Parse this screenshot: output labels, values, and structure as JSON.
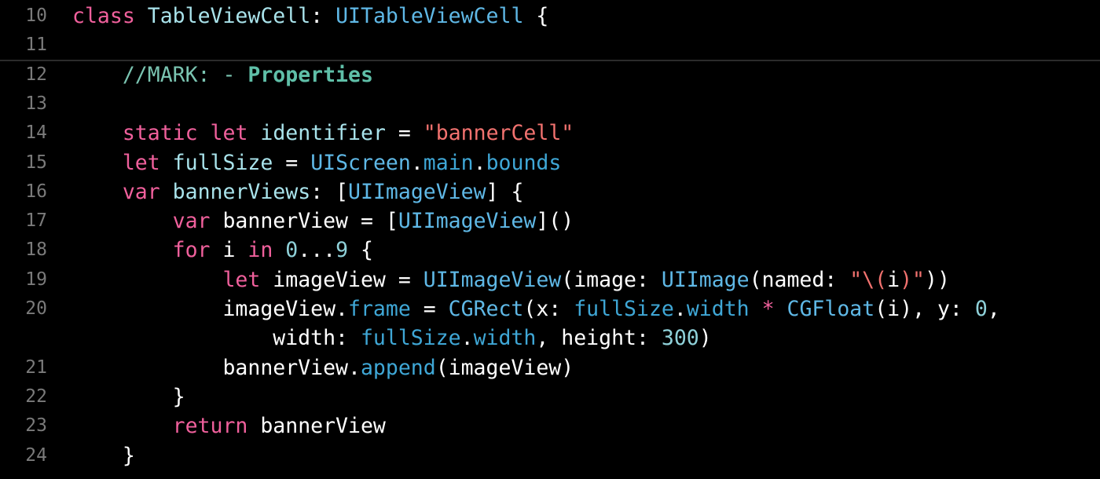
{
  "editor": {
    "background": "#000000",
    "colors": {
      "keyword": "#f0609c",
      "type": "#5fb8e6",
      "declaration": "#a9e3eb",
      "property": "#3fa7d6",
      "string": "#f2726f",
      "number": "#8fd1d9",
      "mark": "#7ac4b1",
      "line_number": "#7a7a7a"
    },
    "lines": [
      {
        "num": "10",
        "tokens": [
          [
            "kw",
            "class"
          ],
          [
            "plain",
            " "
          ],
          [
            "decl",
            "TableViewCell"
          ],
          [
            "plain",
            ": "
          ],
          [
            "type",
            "UITableViewCell"
          ],
          [
            "plain",
            " {"
          ]
        ]
      },
      {
        "num": "11",
        "tokens": []
      },
      {
        "num": "12",
        "tokens": [
          [
            "plain",
            "    "
          ],
          [
            "mark",
            "//MARK: - "
          ],
          [
            "mark-b",
            "Properties"
          ]
        ]
      },
      {
        "num": "13",
        "tokens": []
      },
      {
        "num": "14",
        "tokens": [
          [
            "plain",
            "    "
          ],
          [
            "kw",
            "static"
          ],
          [
            "plain",
            " "
          ],
          [
            "kw",
            "let"
          ],
          [
            "plain",
            " "
          ],
          [
            "decl",
            "identifier"
          ],
          [
            "plain",
            " = "
          ],
          [
            "str",
            "\"bannerCell\""
          ]
        ]
      },
      {
        "num": "15",
        "tokens": [
          [
            "plain",
            "    "
          ],
          [
            "kw",
            "let"
          ],
          [
            "plain",
            " "
          ],
          [
            "decl",
            "fullSize"
          ],
          [
            "plain",
            " = "
          ],
          [
            "type",
            "UIScreen"
          ],
          [
            "plain",
            "."
          ],
          [
            "prop",
            "main"
          ],
          [
            "plain",
            "."
          ],
          [
            "prop",
            "bounds"
          ]
        ]
      },
      {
        "num": "16",
        "tokens": [
          [
            "plain",
            "    "
          ],
          [
            "kw",
            "var"
          ],
          [
            "plain",
            " "
          ],
          [
            "decl",
            "bannerViews"
          ],
          [
            "plain",
            ": ["
          ],
          [
            "type",
            "UIImageView"
          ],
          [
            "plain",
            "] {"
          ]
        ]
      },
      {
        "num": "17",
        "tokens": [
          [
            "plain",
            "        "
          ],
          [
            "kw",
            "var"
          ],
          [
            "plain",
            " bannerView = ["
          ],
          [
            "type",
            "UIImageView"
          ],
          [
            "plain",
            "]()"
          ]
        ]
      },
      {
        "num": "18",
        "tokens": [
          [
            "plain",
            "        "
          ],
          [
            "kw",
            "for"
          ],
          [
            "plain",
            " i "
          ],
          [
            "kw",
            "in"
          ],
          [
            "plain",
            " "
          ],
          [
            "num",
            "0"
          ],
          [
            "plain",
            "..."
          ],
          [
            "num",
            "9"
          ],
          [
            "plain",
            " {"
          ]
        ]
      },
      {
        "num": "19",
        "tokens": [
          [
            "plain",
            "            "
          ],
          [
            "kw",
            "let"
          ],
          [
            "plain",
            " imageView = "
          ],
          [
            "type",
            "UIImageView"
          ],
          [
            "plain",
            "(image: "
          ],
          [
            "type",
            "UIImage"
          ],
          [
            "plain",
            "(named: "
          ],
          [
            "str",
            "\"\\("
          ],
          [
            "plain",
            "i"
          ],
          [
            "str",
            ")\""
          ],
          [
            "plain",
            "))"
          ]
        ]
      },
      {
        "num": "20",
        "tokens": [
          [
            "plain",
            "            imageView."
          ],
          [
            "prop",
            "frame"
          ],
          [
            "plain",
            " = "
          ],
          [
            "type",
            "CGRect"
          ],
          [
            "plain",
            "(x: "
          ],
          [
            "prop",
            "fullSize"
          ],
          [
            "plain",
            "."
          ],
          [
            "prop",
            "width"
          ],
          [
            "plain",
            " "
          ],
          [
            "kw",
            "*"
          ],
          [
            "plain",
            " "
          ],
          [
            "type",
            "CGFloat"
          ],
          [
            "plain",
            "(i), y: "
          ],
          [
            "num",
            "0"
          ],
          [
            "plain",
            ","
          ]
        ]
      },
      {
        "num": "",
        "tokens": [
          [
            "plain",
            "                width: "
          ],
          [
            "prop",
            "fullSize"
          ],
          [
            "plain",
            "."
          ],
          [
            "prop",
            "width"
          ],
          [
            "plain",
            ", height: "
          ],
          [
            "num",
            "300"
          ],
          [
            "plain",
            ")"
          ]
        ]
      },
      {
        "num": "21",
        "tokens": [
          [
            "plain",
            "            bannerView."
          ],
          [
            "prop",
            "append"
          ],
          [
            "plain",
            "(imageView)"
          ]
        ]
      },
      {
        "num": "22",
        "tokens": [
          [
            "plain",
            "        }"
          ]
        ]
      },
      {
        "num": "23",
        "tokens": [
          [
            "plain",
            "        "
          ],
          [
            "kw",
            "return"
          ],
          [
            "plain",
            " bannerView"
          ]
        ]
      },
      {
        "num": "24",
        "tokens": [
          [
            "plain",
            "    }"
          ]
        ]
      }
    ]
  }
}
